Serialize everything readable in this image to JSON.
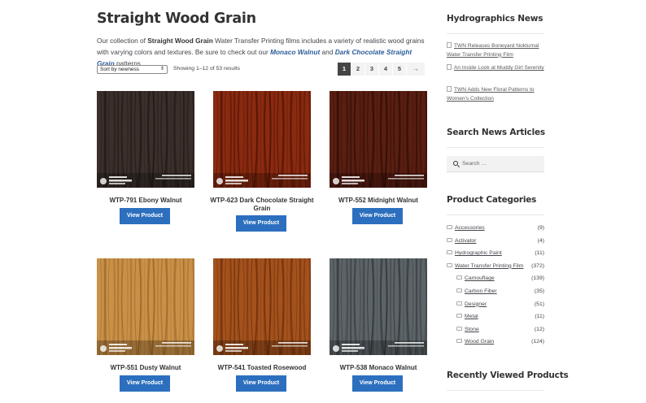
{
  "page": {
    "title": "Straight Wood Grain",
    "intro_1": "Our collection of ",
    "intro_bold": "Straight Wood Grain",
    "intro_2": " Water Transfer Printing films includes a variety of realistic wood grains with varying colors and textures. Be sure to check out our ",
    "intro_link_1": "Monaco Walnut",
    "intro_3": " and ",
    "intro_link_2": "Dark Chocolate Straight Grain",
    "intro_4": " patterns."
  },
  "toolbar": {
    "sort_value": "Sort by newness",
    "result_count": "Showing 1–12 of 53 results"
  },
  "pagination": {
    "pages": [
      "1",
      "2",
      "3",
      "4",
      "5"
    ],
    "current": "1",
    "next": "→"
  },
  "products": [
    {
      "title": "WTP-791 Ebony Walnut",
      "button": "View Product",
      "swatch": "ebony",
      "base": "#3a2f2a",
      "grain": "#1e1714"
    },
    {
      "title": "WTP-623 Dark Chocolate Straight Grain",
      "button": "View Product",
      "swatch": "dark-chocolate",
      "base": "#8a2a10",
      "grain": "#4a1205"
    },
    {
      "title": "WTP-552 Midnight Walnut",
      "button": "View Product",
      "swatch": "midnight",
      "base": "#5a1e12",
      "grain": "#2a0c06"
    },
    {
      "title": "WTP-551 Dusty Walnut",
      "button": "View Product",
      "swatch": "dusty",
      "base": "#c99148",
      "grain": "#9a6428"
    },
    {
      "title": "WTP-541 Toasted Rosewood",
      "button": "View Product",
      "swatch": "toasted-rosewood",
      "base": "#a4521c",
      "grain": "#6a2c0c"
    },
    {
      "title": "WTP-538 Monaco Walnut",
      "button": "View Product",
      "swatch": "monaco",
      "base": "#5c6468",
      "grain": "#2e3336"
    }
  ],
  "sidebar": {
    "news_title": "Hydrographics News",
    "news": [
      "TWN Releases Boneyard Nokturnal Water Transfer Printing Film",
      "An Inside Look at Muddy Girl Serenity",
      "TWN Adds New Floral Patterns to Women's Collection"
    ],
    "search_title": "Search News Articles",
    "search_placeholder": "Search …",
    "categories_title": "Product Categories",
    "categories": [
      {
        "label": "Accessories",
        "count": "(9)",
        "sub": false
      },
      {
        "label": "Activator",
        "count": "(4)",
        "sub": false
      },
      {
        "label": "Hydrographic Paint",
        "count": "(11)",
        "sub": false
      },
      {
        "label": "Water Transfer Printing Film",
        "count": "(372)",
        "sub": false
      },
      {
        "label": "Camouflage",
        "count": "(139)",
        "sub": true
      },
      {
        "label": "Carbon Fiber",
        "count": "(35)",
        "sub": true
      },
      {
        "label": "Designer",
        "count": "(51)",
        "sub": true
      },
      {
        "label": "Metal",
        "count": "(11)",
        "sub": true
      },
      {
        "label": "Stone",
        "count": "(12)",
        "sub": true
      },
      {
        "label": "Wood Grain",
        "count": "(124)",
        "sub": true
      }
    ],
    "recent_title": "Recently Viewed Products"
  }
}
